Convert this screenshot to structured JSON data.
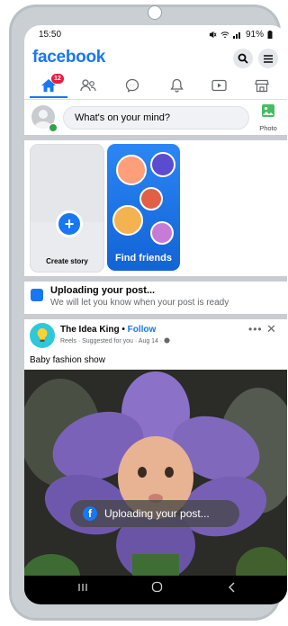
{
  "status_bar": {
    "time": "15:50",
    "battery": "91%"
  },
  "app": {
    "logo": "facebook"
  },
  "nav": {
    "home_badge": "12"
  },
  "composer": {
    "placeholder": "What's on your mind?",
    "photo_label": "Photo"
  },
  "stories": {
    "create_label": "Create story",
    "find_label": "Find friends"
  },
  "upload_banner": {
    "title": "Uploading your post...",
    "subtitle": "We will let you know when your post is ready"
  },
  "post": {
    "author": "The Idea King",
    "separator": " • ",
    "follow": "Follow",
    "meta": "Reels · Suggested for you · Aug 14 ·",
    "caption": "Baby fashion show",
    "more": "•••",
    "close": "✕"
  },
  "toast": {
    "text": "Uploading your post..."
  },
  "colors": {
    "brand": "#1877f2",
    "badge": "#e41e3f"
  },
  "icons": [
    "home-icon",
    "friends-icon",
    "messenger-icon",
    "notifications-icon",
    "video-icon",
    "marketplace-icon",
    "search-icon",
    "menu-icon"
  ]
}
